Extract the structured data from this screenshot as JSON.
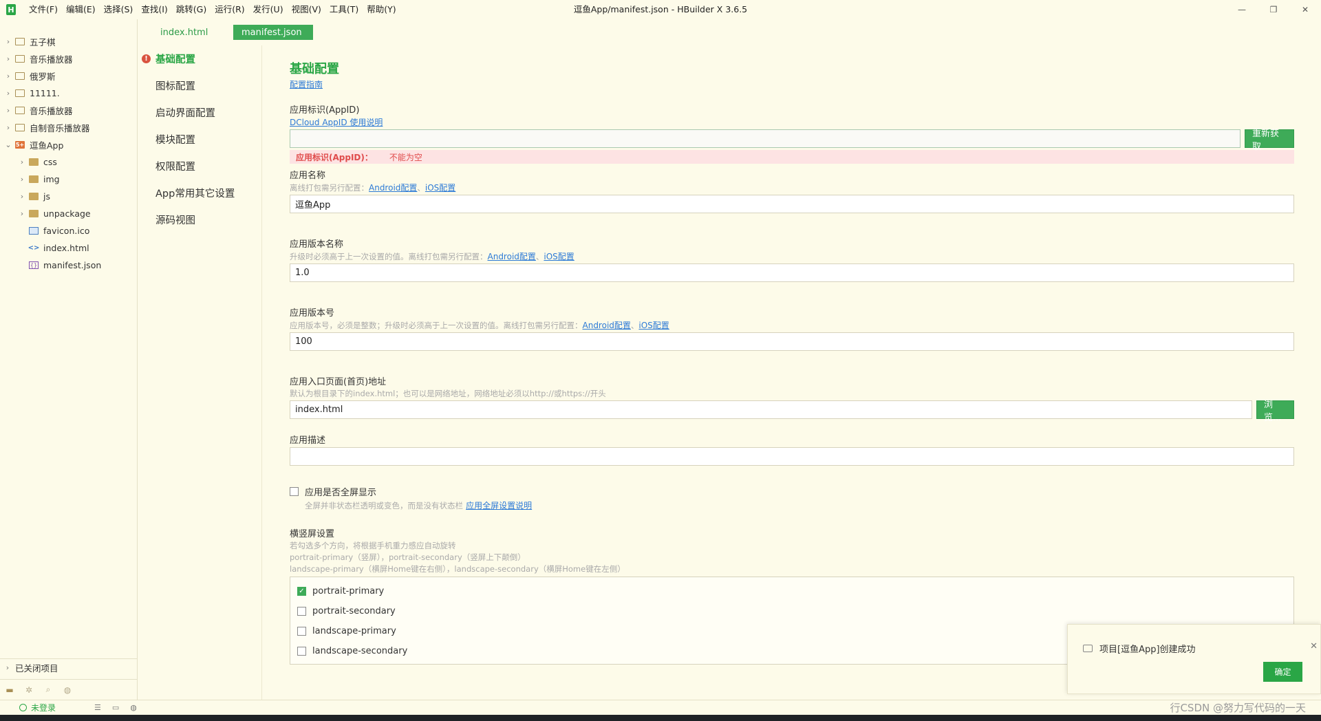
{
  "titlebar": {
    "logo": "H",
    "menu": [
      "文件(F)",
      "编辑(E)",
      "选择(S)",
      "查找(I)",
      "跳转(G)",
      "运行(R)",
      "发行(U)",
      "视图(V)",
      "工具(T)",
      "帮助(Y)"
    ],
    "window_title": "逗鱼App/manifest.json - HBuilder X 3.6.5",
    "controls": {
      "minimize": "—",
      "restore": "❐",
      "close": "✕"
    }
  },
  "explorer": {
    "items": [
      {
        "label": "五子棋",
        "type": "project"
      },
      {
        "label": "音乐播放器",
        "type": "project"
      },
      {
        "label": "俄罗斯",
        "type": "project"
      },
      {
        "label": "11111.",
        "type": "project"
      },
      {
        "label": "音乐播放器",
        "type": "project"
      },
      {
        "label": "自制音乐播放器",
        "type": "project"
      },
      {
        "label": "逗鱼App",
        "type": "app",
        "expanded": true
      },
      {
        "label": "css",
        "type": "folder"
      },
      {
        "label": "img",
        "type": "folder"
      },
      {
        "label": "js",
        "type": "folder"
      },
      {
        "label": "unpackage",
        "type": "folder"
      },
      {
        "label": "favicon.ico",
        "type": "image-file"
      },
      {
        "label": "index.html",
        "type": "code-file"
      },
      {
        "label": "manifest.json",
        "type": "json-file"
      }
    ],
    "closed_projects": "已关闭项目"
  },
  "tabs": [
    {
      "label": "index.html",
      "active": false
    },
    {
      "label": "manifest.json",
      "active": true
    }
  ],
  "nav": [
    {
      "label": "基础配置",
      "active": true,
      "warning": "!"
    },
    {
      "label": "图标配置"
    },
    {
      "label": "启动界面配置"
    },
    {
      "label": "模块配置"
    },
    {
      "label": "权限配置"
    },
    {
      "label": "App常用其它设置"
    },
    {
      "label": "源码视图"
    }
  ],
  "content": {
    "title": "基础配置",
    "guide_link": "配置指南",
    "appid": {
      "label": "应用标识(AppID)",
      "link": "DCloud AppID 使用说明",
      "value": "",
      "button": "重新获取",
      "error_field": "应用标识(AppID)：",
      "error_msg": "不能为空"
    },
    "app_name": {
      "label": "应用名称",
      "hint": "离线打包需另行配置：",
      "android_link": "Android配置",
      "ios_link": "iOS配置",
      "value": "逗鱼App"
    },
    "version_name": {
      "label": "应用版本名称",
      "hint": "升级时必须高于上一次设置的值。离线打包需另行配置：",
      "android_link": "Android配置",
      "ios_link": "iOS配置",
      "value": "1.0"
    },
    "version_code": {
      "label": "应用版本号",
      "hint": "应用版本号，必须是整数；升级时必须高于上一次设置的值。离线打包需另行配置：",
      "android_link": "Android配置",
      "ios_link": "iOS配置",
      "value": "100"
    },
    "entry": {
      "label": "应用入口页面(首页)地址",
      "hint": "默认为根目录下的index.html；也可以是网络地址，网络地址必须以http://或https://开头",
      "value": "index.html",
      "button": "浏览..."
    },
    "description": {
      "label": "应用描述",
      "value": ""
    },
    "fullscreen": {
      "label": "应用是否全屏显示",
      "checked": false,
      "hint": "全屏并非状态栏透明或变色，而是没有状态栏",
      "link": "应用全屏设置说明"
    },
    "orientation": {
      "label": "横竖屏设置",
      "hint1": "若勾选多个方向，将根据手机重力感应自动旋转",
      "hint2": "portrait-primary（竖屏），portrait-secondary（竖屏上下颠倒）",
      "hint3": "landscape-primary（横屏Home键在右侧），landscape-secondary（横屏Home键在左侧）",
      "options": [
        {
          "label": "portrait-primary",
          "checked": true
        },
        {
          "label": "portrait-secondary",
          "checked": false
        },
        {
          "label": "landscape-primary",
          "checked": false
        },
        {
          "label": "landscape-secondary",
          "checked": false
        }
      ]
    }
  },
  "toast": {
    "message": "项目[逗鱼App]创建成功",
    "ok": "确定",
    "close": "✕"
  },
  "statusbar": {
    "login": "未登录",
    "right_text": "行CSDN @努力写代码的一天"
  },
  "colors": {
    "accent": "#2aa646",
    "background": "#fdfbe9",
    "error": "#e04c4c",
    "link": "#2c7ad6"
  }
}
